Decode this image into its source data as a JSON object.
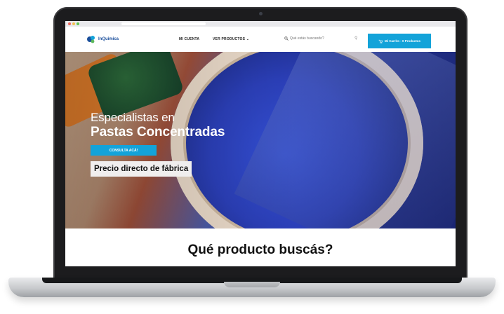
{
  "browser": {
    "url": ""
  },
  "header": {
    "logo_text": "InQuimica",
    "nav": [
      {
        "label": "MI CUENTA"
      },
      {
        "label": "VER PRODUCTOS"
      }
    ],
    "search": {
      "placeholder": "Qué estás buscando?"
    },
    "cart_label": "Mi Carrito - 0 Productos"
  },
  "hero": {
    "title_line1": "Especialistas en",
    "title_line2": "Pastas Concentradas",
    "cta_label": "CONSULTA ACÁ!",
    "price_text": "Precio directo de fábrica"
  },
  "section": {
    "title": "Qué producto buscás?"
  },
  "colors": {
    "accent": "#13a3d9",
    "logo": "#1b4f9c",
    "laptop": "#1c1c1e"
  },
  "icons": [
    "logo-icon",
    "search-icon",
    "cart-icon",
    "chevron-down-icon"
  ]
}
